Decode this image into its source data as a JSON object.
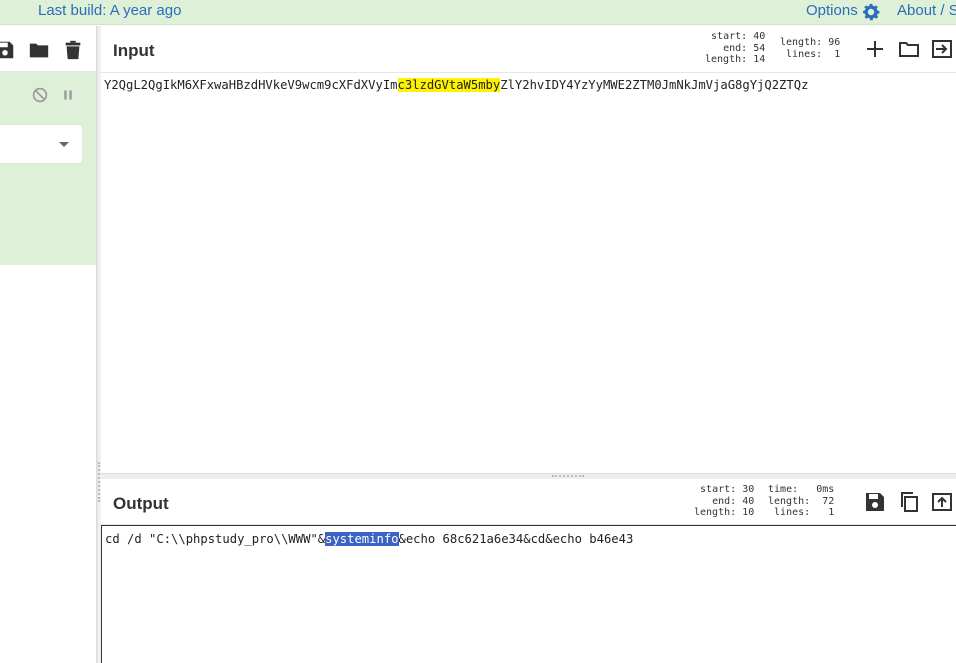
{
  "banner": {
    "last_build": "Last build: A year ago",
    "options_label": "Options",
    "options_icon": "gear-icon",
    "about_label": "About / S",
    "background": "#dff0d8",
    "link_color": "#2a6ebb"
  },
  "recipe": {
    "toolbar_icons": [
      "save-icon",
      "folder-icon",
      "trash-icon"
    ],
    "operation_icons": [
      "disable-icon",
      "pause-icon"
    ],
    "operation_background": "#dff0d8"
  },
  "input": {
    "title": "Input",
    "stats": {
      "start_label": "start:",
      "start": "40",
      "end_label": "end:",
      "end": "54",
      "length_label": "length:",
      "length": "14",
      "total_length_label": "length:",
      "total_length": "96",
      "lines_label": "lines:",
      "lines": "1"
    },
    "icons": [
      "plus-icon",
      "open-folder-icon",
      "input-switch-icon"
    ],
    "text_before": "Y2QgL2QgIkM6XFxwaHBzdHVkeV9wcm9cXFdXVyIm",
    "text_highlight": "c3lzdGVtaW5mby",
    "text_after": "ZlY2hvIDY4YzYyMWE2ZTM0JmNkJmVjaG8gYjQ2ZTQz",
    "highlight_color": "#fff200"
  },
  "output": {
    "title": "Output",
    "stats": {
      "start_label": "start:",
      "start": "30",
      "end_label": "end:",
      "end": "40",
      "length_label": "length:",
      "length": "10",
      "time_label": "time:",
      "time": "0ms",
      "total_length_label": "length:",
      "total_length": "72",
      "lines_label": "lines:",
      "lines": "1"
    },
    "icons": [
      "save-icon",
      "copy-icon",
      "replace-input-icon"
    ],
    "text_before": "cd /d \"C:\\\\phpstudy_pro\\\\WWW\"&",
    "text_highlight": "systeminfo",
    "text_after": "&echo 68c621a6e34&cd&echo b46e43",
    "highlight_color": "#3b63c4"
  }
}
